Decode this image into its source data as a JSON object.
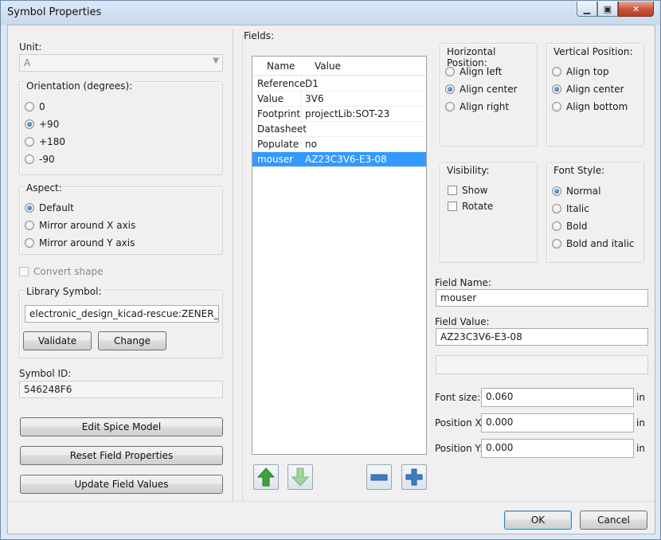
{
  "window": {
    "title": "Symbol Properties"
  },
  "unit": {
    "label": "Unit:",
    "value": "A"
  },
  "orientation": {
    "label": "Orientation (degrees):",
    "options": [
      "0",
      "+90",
      "+180",
      "-90"
    ],
    "selected": "+90"
  },
  "aspect": {
    "label": "Aspect:",
    "options": [
      "Default",
      "Mirror around X axis",
      "Mirror around Y axis"
    ],
    "selected": "Default"
  },
  "convert_shape": {
    "label": "Convert shape",
    "checked": false
  },
  "library_symbol": {
    "label": "Library Symbol:",
    "value": "electronic_design_kicad-rescue:ZENER_DUAL",
    "validate": "Validate",
    "change": "Change"
  },
  "symbol_id": {
    "label": "Symbol ID:",
    "value": "546248F6"
  },
  "buttons": {
    "edit_spice": "Edit Spice Model",
    "reset_fields": "Reset Field Properties",
    "update_fields": "Update Field Values",
    "ok": "OK",
    "cancel": "Cancel"
  },
  "fields": {
    "label": "Fields:",
    "columns": [
      "Name",
      "Value"
    ],
    "rows": [
      {
        "name": "Reference",
        "value": "D1"
      },
      {
        "name": "Value",
        "value": "3V6"
      },
      {
        "name": "Footprint",
        "value": "projectLib:SOT-23"
      },
      {
        "name": "Datasheet",
        "value": ""
      },
      {
        "name": "Populate",
        "value": "no"
      },
      {
        "name": "mouser",
        "value": "AZ23C3V6-E3-08"
      }
    ],
    "selected_row": 5
  },
  "horizontal_position": {
    "label": "Horizontal Position:",
    "options": [
      "Align left",
      "Align center",
      "Align right"
    ],
    "selected": "Align center"
  },
  "vertical_position": {
    "label": "Vertical Position:",
    "options": [
      "Align top",
      "Align center",
      "Align bottom"
    ],
    "selected": "Align center"
  },
  "visibility": {
    "label": "Visibility:",
    "show": "Show",
    "rotate": "Rotate",
    "show_checked": false,
    "rotate_checked": false
  },
  "font_style": {
    "label": "Font Style:",
    "options": [
      "Normal",
      "Italic",
      "Bold",
      "Bold and italic"
    ],
    "selected": "Normal"
  },
  "field_name": {
    "label": "Field Name:",
    "value": "mouser"
  },
  "field_value": {
    "label": "Field Value:",
    "value": "AZ23C3V6-E3-08"
  },
  "font_size": {
    "label": "Font size:",
    "value": "0.060",
    "unit": "in"
  },
  "position_x": {
    "label": "Position X:",
    "value": "0.000",
    "unit": "in"
  },
  "position_y": {
    "label": "Position Y:",
    "value": "0.000",
    "unit": "in"
  },
  "colors": {
    "accent": "#3399ff",
    "move_up_icon": "#3fa23a",
    "move_down_icon": "#9fd49a",
    "add_remove_icon": "#3e7cc2"
  }
}
